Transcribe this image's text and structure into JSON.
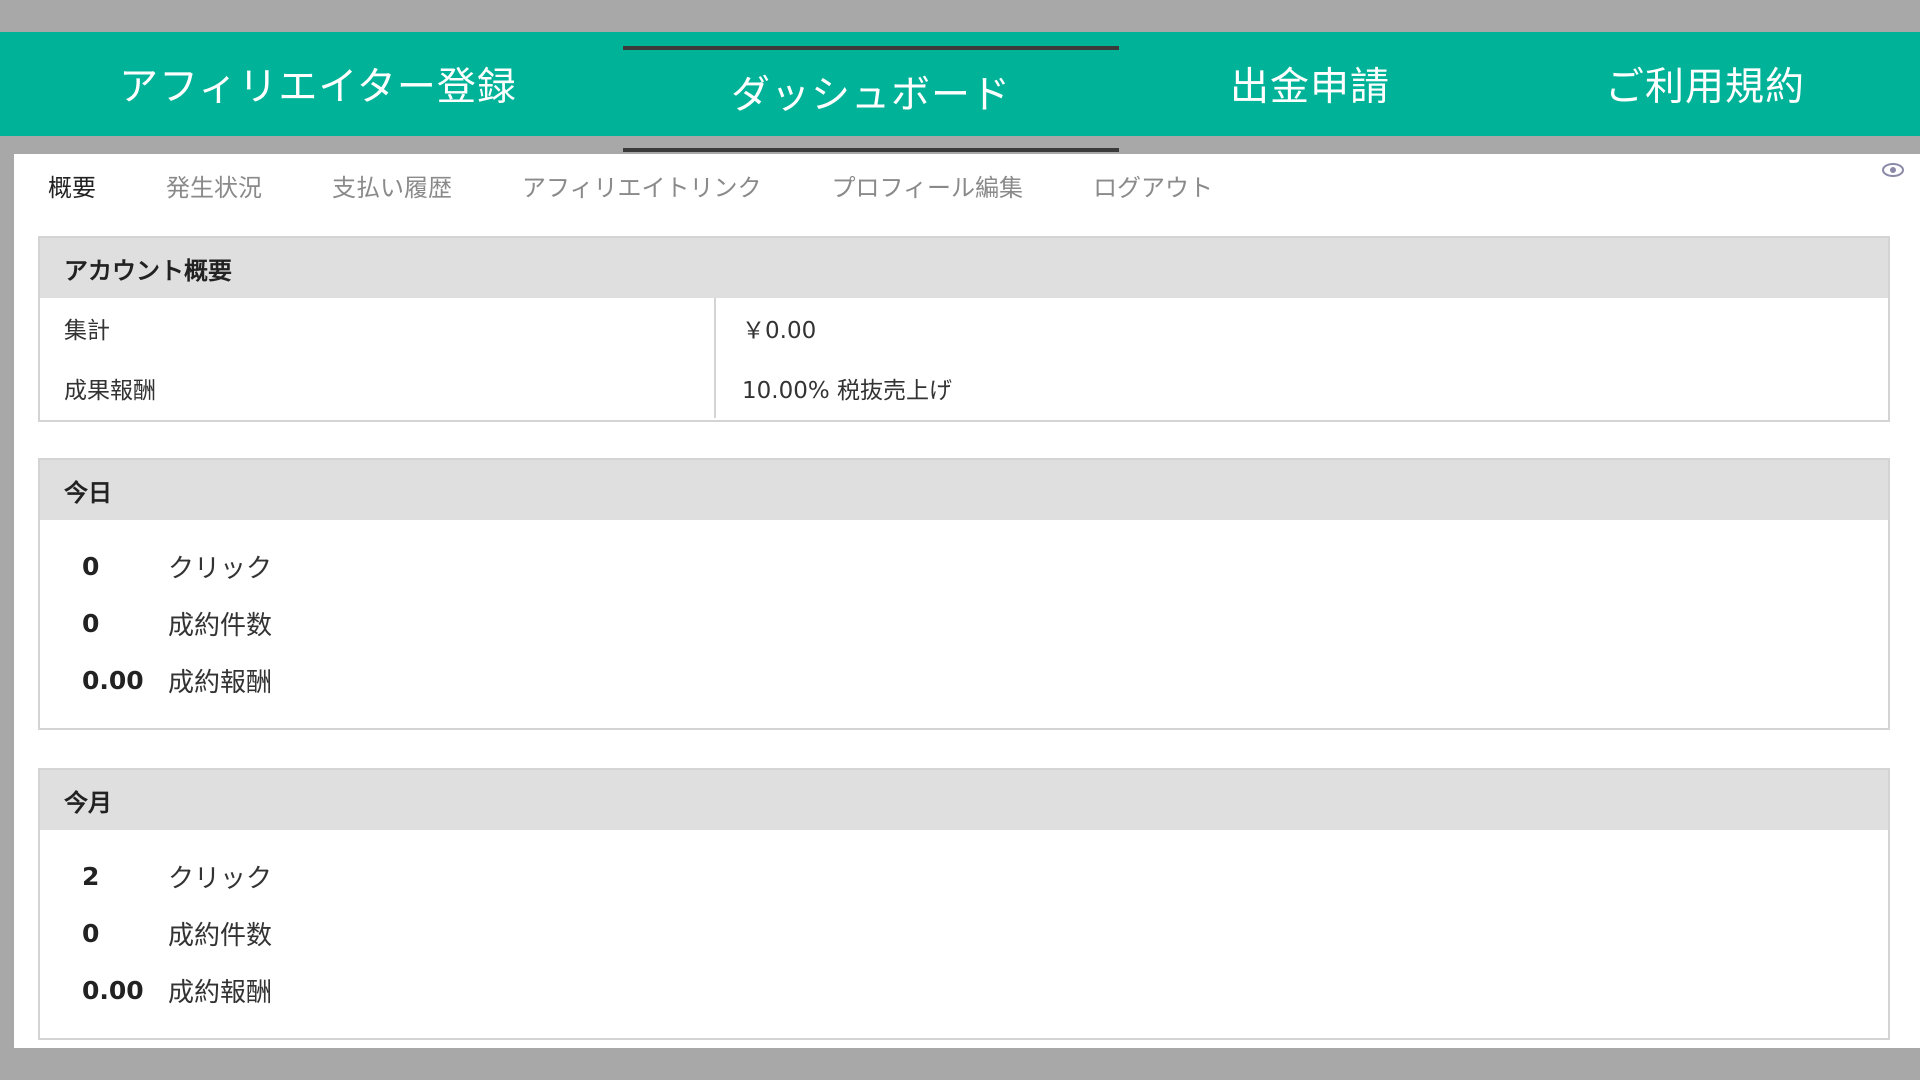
{
  "topnav": {
    "items": [
      {
        "label": "アフィリエイター登録"
      },
      {
        "label": "ダッシュボード"
      },
      {
        "label": "出金申請"
      },
      {
        "label": "ご利用規約"
      }
    ],
    "active": "ダッシュボード"
  },
  "subnav": {
    "items": [
      {
        "label": "概要"
      },
      {
        "label": "発生状況"
      },
      {
        "label": "支払い履歴"
      },
      {
        "label": "アフィリエイトリンク"
      },
      {
        "label": "プロフィール編集"
      },
      {
        "label": "ログアウト"
      }
    ],
    "active": "概要"
  },
  "account_summary": {
    "title": "アカウント概要",
    "rows": [
      {
        "key": "集計",
        "value": "￥0.00"
      },
      {
        "key": "成果報酬",
        "value": "10.00% 税抜売上げ"
      }
    ]
  },
  "today": {
    "title": "今日",
    "stats": [
      {
        "value": "0",
        "label": "クリック"
      },
      {
        "value": "0",
        "label": "成約件数"
      },
      {
        "value": "0.00",
        "label": "成約報酬"
      }
    ]
  },
  "this_month": {
    "title": "今月",
    "stats": [
      {
        "value": "2",
        "label": "クリック"
      },
      {
        "value": "0",
        "label": "成約件数"
      },
      {
        "value": "0.00",
        "label": "成約報酬"
      }
    ]
  },
  "icons": {
    "visibility": "eye-icon"
  },
  "colors": {
    "brand": "#00b398",
    "panel_header": "#dfdfdf",
    "frame": "#a8a8a8"
  }
}
